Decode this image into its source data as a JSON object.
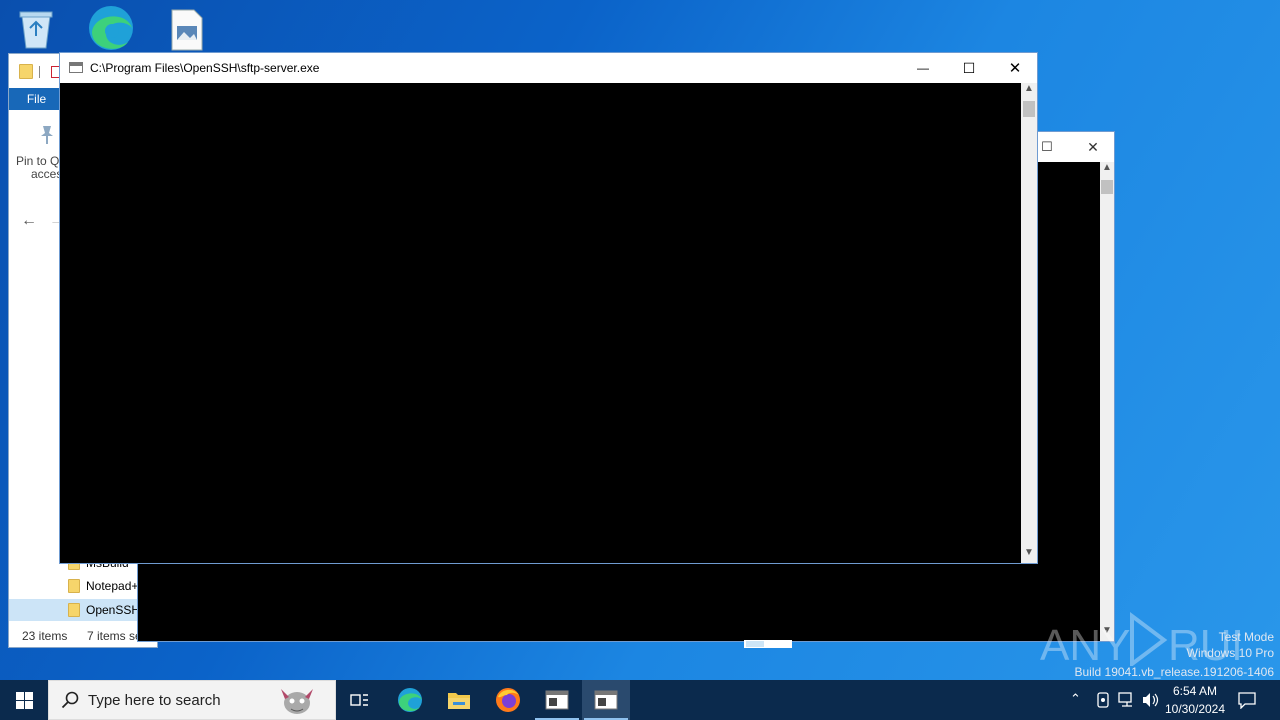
{
  "desktop": {
    "icons": [
      "recycle-bin-icon",
      "edge-shortcut-icon",
      "image-file-icon"
    ]
  },
  "explorer": {
    "file_tab": "File",
    "pin_label_line1": "Pin to Qu",
    "pin_label_line2": "acces",
    "tree_items": [
      {
        "label": "MsBuild"
      },
      {
        "label": "Notepad++"
      },
      {
        "label": "OpenSSH",
        "selected": true
      }
    ],
    "status_items": "23 items",
    "status_selected": "7 items se"
  },
  "console_front": {
    "title": "C:\\Program Files\\OpenSSH\\sftp-server.exe",
    "minimize": "—",
    "maximize": "☐",
    "close": "✕"
  },
  "console_back": {
    "maximize": "☐",
    "close": "✕"
  },
  "taskbar": {
    "search_placeholder": "Type here to search",
    "time": "6:54 AM",
    "date": "10/30/2024",
    "colors": {
      "background": "#0b2a4d",
      "active_indicator": "#8fc1ee"
    }
  },
  "watermark": {
    "line1": "Test Mode",
    "line2": "Windows 10 Pro",
    "line3": "Build 19041.vb_release.191206-1406",
    "brand": "ANY RUN"
  }
}
